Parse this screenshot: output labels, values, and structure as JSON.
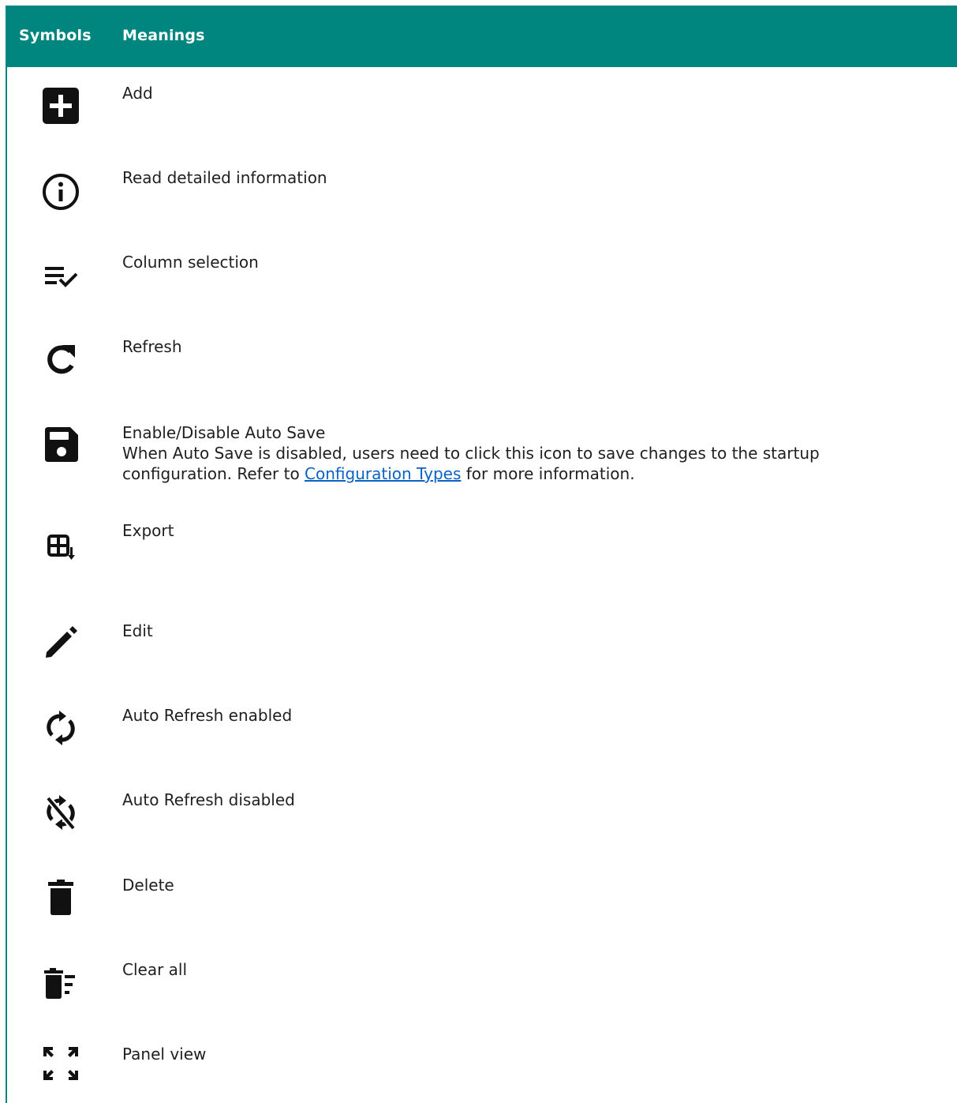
{
  "header": {
    "symbols": "Symbols",
    "meanings": "Meanings"
  },
  "rows": [
    {
      "icon": "add-icon",
      "meaning": "Add"
    },
    {
      "icon": "info-icon",
      "meaning": "Read detailed information"
    },
    {
      "icon": "column-selection-icon",
      "meaning": "Column selection"
    },
    {
      "icon": "refresh-icon",
      "meaning": "Refresh"
    },
    {
      "icon": "save-icon",
      "meaning": "Enable/Disable Auto Save",
      "detail_before": "When Auto Save is disabled, users need to click this icon to save changes to the startup configuration. Refer to ",
      "detail_link": "Configuration Types",
      "detail_after": " for more information."
    },
    {
      "icon": "export-icon",
      "meaning": "Export"
    },
    {
      "icon": "edit-icon",
      "meaning": "Edit"
    },
    {
      "icon": "auto-refresh-enabled-icon",
      "meaning": "Auto Refresh enabled"
    },
    {
      "icon": "auto-refresh-disabled-icon",
      "meaning": "Auto Refresh disabled"
    },
    {
      "icon": "delete-icon",
      "meaning": "Delete"
    },
    {
      "icon": "clear-all-icon",
      "meaning": "Clear all"
    },
    {
      "icon": "panel-view-icon",
      "meaning": "Panel view"
    }
  ],
  "colors": {
    "header_bg": "#00857f",
    "link": "#0b62c4"
  }
}
